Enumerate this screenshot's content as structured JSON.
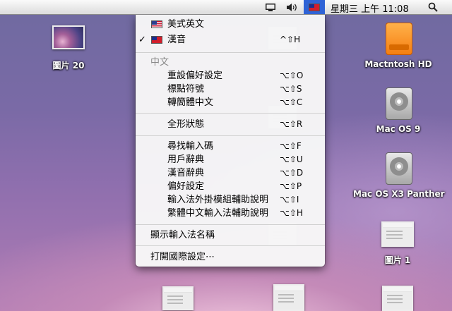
{
  "menubar": {
    "clock": "星期三 上午 11:08"
  },
  "desktop": {
    "icons": [
      {
        "label": "圖片 20"
      },
      {
        "label": "Mactntosh HD"
      },
      {
        "label": "Mac OS 9"
      },
      {
        "label": "Mac OS X3 Panther"
      },
      {
        "label": "圖片 1"
      }
    ]
  },
  "input_menu": {
    "items": [
      {
        "label": "美式英文",
        "shortcut": ""
      },
      {
        "label": "漢音",
        "shortcut": "^⇧H",
        "checked": true
      }
    ],
    "section_header": "中文",
    "group1": [
      {
        "label": "重設偏好設定",
        "shortcut": "⌥⇧O"
      },
      {
        "label": "標點符號",
        "shortcut": "⌥⇧S"
      },
      {
        "label": "轉簡體中文",
        "shortcut": "⌥⇧C"
      }
    ],
    "group2": [
      {
        "label": "全形狀態",
        "shortcut": "⌥⇧R"
      }
    ],
    "group3": [
      {
        "label": "尋找輸入碼",
        "shortcut": "⌥⇧F"
      },
      {
        "label": "用戶辭典",
        "shortcut": "⌥⇧U"
      },
      {
        "label": "漢音辭典",
        "shortcut": "⌥⇧D"
      },
      {
        "label": "偏好設定",
        "shortcut": "⌥⇧P"
      },
      {
        "label": "輸入法外掛模組輔助說明",
        "shortcut": "⌥⇧I"
      },
      {
        "label": "繁體中文輸入法輔助說明",
        "shortcut": "⌥⇧H"
      }
    ],
    "show_name": "顯示輸入法名稱",
    "open_intl": "打開國際設定⋯"
  }
}
